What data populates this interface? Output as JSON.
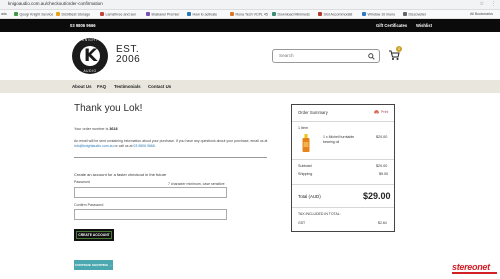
{
  "browser": {
    "url": "knigoaudio.com.au/checkout/order-confirmation",
    "bookmarks": [
      {
        "label": "ads",
        "color": "#4a90e2"
      },
      {
        "label": "Qoogi Knight Service",
        "color": "#3c9a48"
      },
      {
        "label": "Distribest Storage",
        "color": "#e8a21b"
      },
      {
        "label": "Lamsthree and sen",
        "color": "#c2463a"
      },
      {
        "label": "Brabanel Premier",
        "color": "#7a4fb8"
      },
      {
        "label": "How to activate",
        "color": "#2a7ab8"
      },
      {
        "label": "Rona Tech VCPL 45",
        "color": "#d9772a"
      },
      {
        "label": "Download Minimeds",
        "color": "#3b8d74"
      },
      {
        "label": "Slot Accommodati",
        "color": "#b5392e"
      },
      {
        "label": "Window 10 menu",
        "color": "#2d79c7"
      },
      {
        "label": "Discoveller",
        "color": "#666666"
      }
    ],
    "more_label": "All Bookmarks"
  },
  "topbar": {
    "phone": "03 9806 9666",
    "gift_certificates": "Gift Certificates",
    "wishlist": "Wishlist"
  },
  "header": {
    "logo_top": "KNIGHT",
    "logo_bottom": "AUDIO",
    "logo_letter": "K",
    "est_label": "EST.",
    "est_year": "2006",
    "search_placeholder": "Search",
    "cart_count": "0"
  },
  "nav": {
    "items": [
      "About Us",
      "FAQ",
      "Testimonials",
      "Contact Us"
    ]
  },
  "confirmation": {
    "title": "Thank you Lok!",
    "order_number_label": "Your order number is ",
    "order_number": "3618",
    "email_note_pre": "An email will be sent containing information about your purchase. If you have any questions about your purchase, email us at ",
    "email": "info@knightaudio.com.au",
    "email_note_mid": " or call us at ",
    "phone": "03 9806 9666",
    "email_note_post": ".",
    "create_account_label": "Create an account for a faster checkout in the future",
    "password_label": "Password",
    "password_hint": "7 character minimum, case sensitive",
    "confirm_password_label": "Confirm Password",
    "create_account_button": "CREATE ACCOUNT",
    "continue_button": "CONTINUE SHOPPING →"
  },
  "summary": {
    "title": "Order Summary",
    "print_label": "Print",
    "items_count": "1 Item",
    "product_name": "1 x Michell turntable bearing oil",
    "product_price": "$20.00",
    "subtotal_label": "Subtotal",
    "subtotal_value": "$20.00",
    "shipping_label": "Shipping",
    "shipping_value": "$9.00",
    "total_label": "Total (AUD)",
    "total_value": "$29.00",
    "tax_label": "TAX INCLUDED IN TOTAL:",
    "gst_label": "GST",
    "gst_value": "$2.64"
  },
  "watermark": {
    "text": "stereonet"
  },
  "colors": {
    "topbar": "#0b0b0b",
    "nav": "#e8e6dd",
    "accent_teal": "#4ba8b0",
    "badge_gold": "#c9a227",
    "watermark_red": "#d21f26"
  }
}
